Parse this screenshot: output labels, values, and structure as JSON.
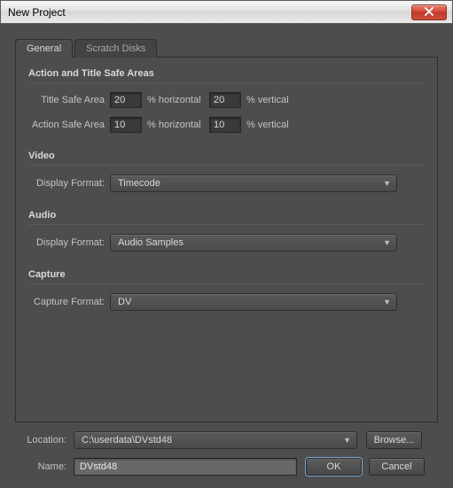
{
  "window": {
    "title": "New Project"
  },
  "tabs": {
    "general": "General",
    "scratch": "Scratch Disks"
  },
  "groups": {
    "safe": {
      "title": "Action and Title Safe Areas",
      "title_safe_label": "Title Safe Area",
      "action_safe_label": "Action Safe Area",
      "pct_horizontal": "% horizontal",
      "pct_vertical": "% vertical",
      "title_h": "20",
      "title_v": "20",
      "action_h": "10",
      "action_v": "10"
    },
    "video": {
      "title": "Video",
      "display_format_label": "Display Format:",
      "display_format_value": "Timecode"
    },
    "audio": {
      "title": "Audio",
      "display_format_label": "Display Format:",
      "display_format_value": "Audio Samples"
    },
    "capture": {
      "title": "Capture",
      "capture_format_label": "Capture Format:",
      "capture_format_value": "DV"
    }
  },
  "footer": {
    "location_label": "Location:",
    "location_value": "C:\\userdata\\DVstd48",
    "name_label": "Name:",
    "name_value": "DVstd48",
    "browse": "Browse...",
    "ok": "OK",
    "cancel": "Cancel"
  }
}
